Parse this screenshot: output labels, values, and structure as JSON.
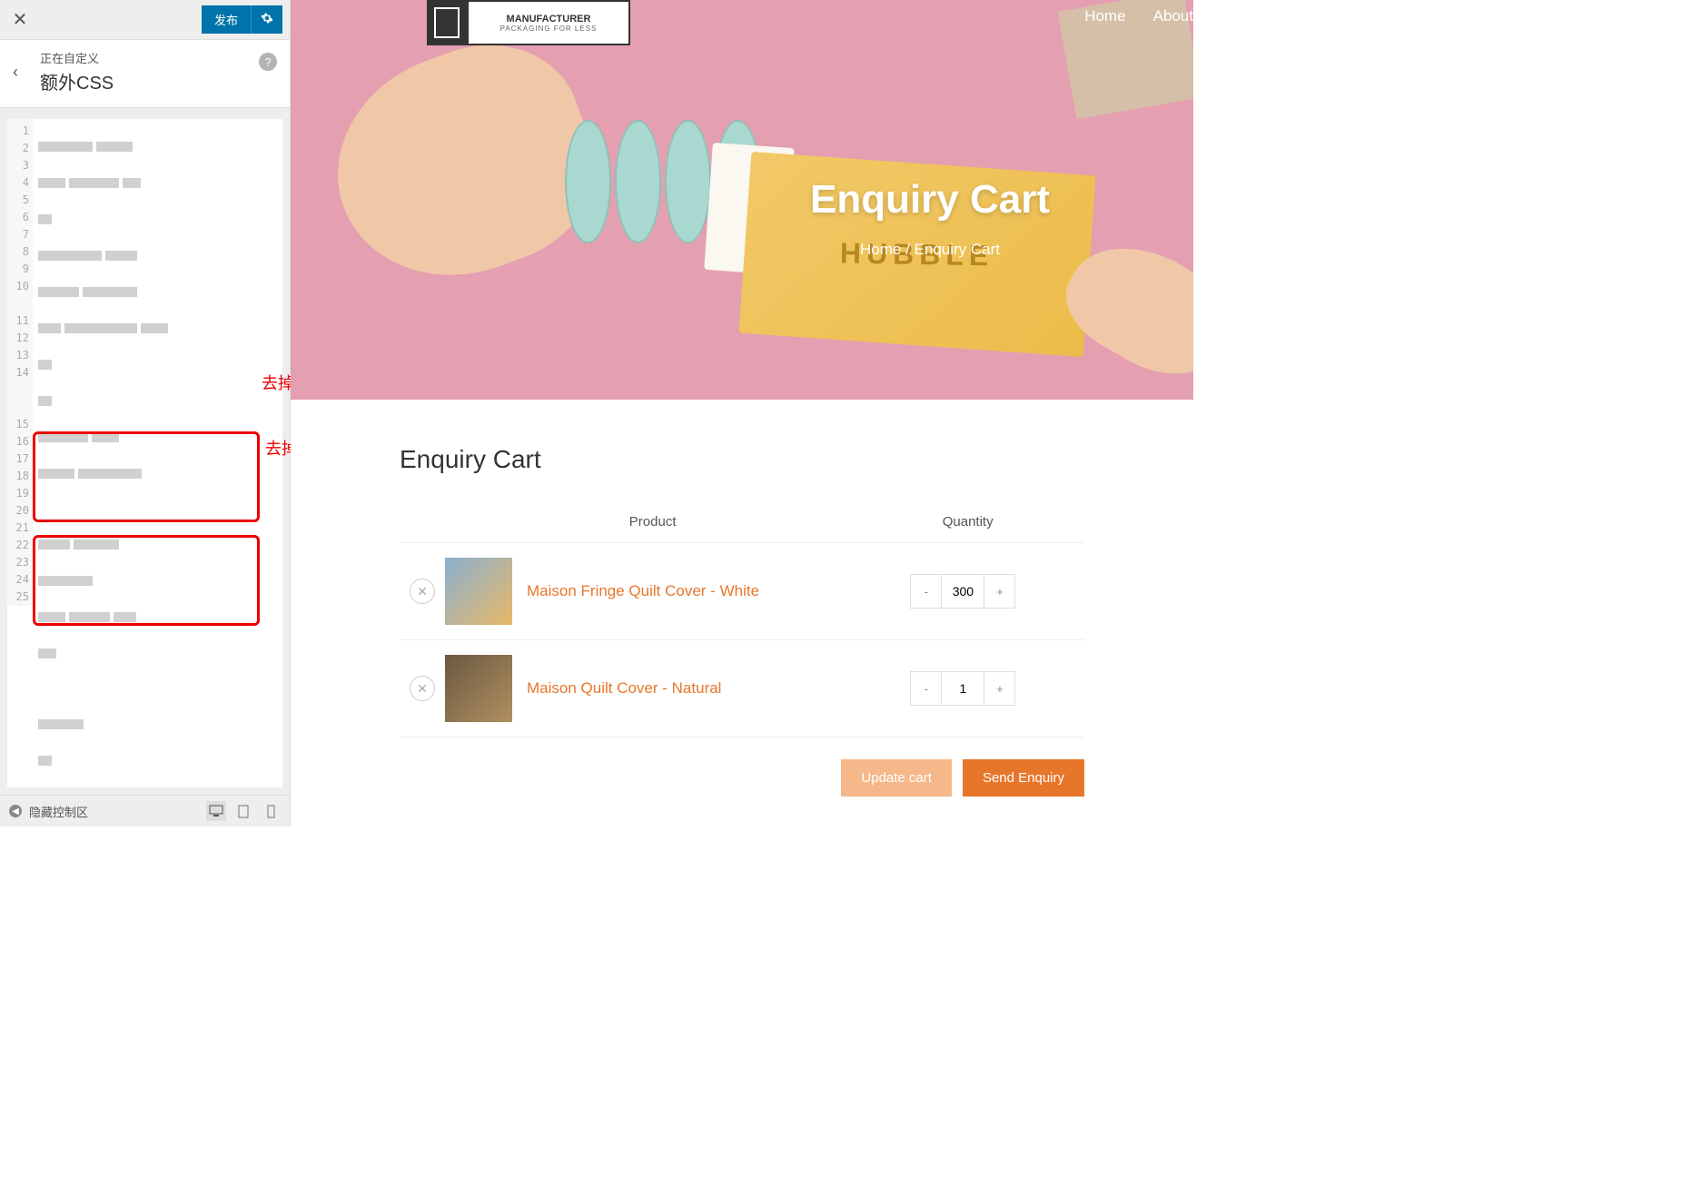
{
  "sidebar": {
    "publish_label": "发布",
    "customizing_label": "正在自定义",
    "section_title": "额外CSS",
    "footer_label": "隐藏控制区"
  },
  "code": {
    "line_start": 1,
    "block1_lines": [
      ".woocommerce table.cart td:nth-of-type(4), .woocommerce table.cart th:nth-of-type(4) {",
      "display: none;",
      "}"
    ],
    "block2_lines": [
      ".woocommerce table.cart td:nth-of-type(6), .woocommerce table.cart th:nth-of-type(6) {",
      "display: none;",
      "}"
    ]
  },
  "annotations": {
    "box1_label": "去掉price列",
    "box2_label": "去掉subtotal列"
  },
  "preview": {
    "logo_line1": "MANUFACTURER",
    "logo_line2": "PACKAGING FOR LESS",
    "box_brand": "HUBBLE",
    "nav": [
      "Home",
      "About"
    ],
    "hero_title": "Enquiry Cart",
    "breadcrumb_home": "Home",
    "breadcrumb_sep": "/",
    "breadcrumb_current": "Enquiry Cart",
    "content_title": "Enquiry Cart",
    "table": {
      "headers": {
        "product": "Product",
        "quantity": "Quantity"
      },
      "rows": [
        {
          "name": "Maison Fringe Quilt Cover - White",
          "qty": "300"
        },
        {
          "name": "Maison Quilt Cover - Natural",
          "qty": "1"
        }
      ]
    },
    "actions": {
      "update": "Update cart",
      "send": "Send Enquiry"
    }
  }
}
